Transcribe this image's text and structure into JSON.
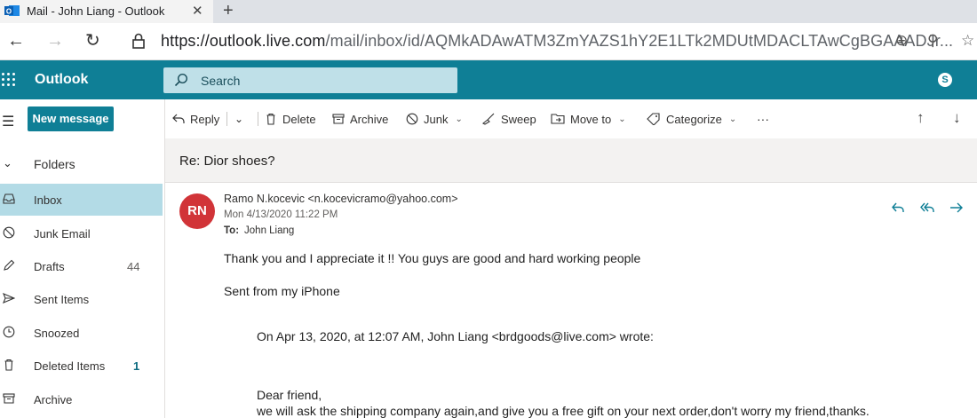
{
  "browser": {
    "tab_title": "Mail - John Liang - Outlook",
    "tab_close": "✕",
    "new_tab": "+",
    "back": "←",
    "forward": "→",
    "refresh": "↻",
    "url_host": "https://outlook.live.com",
    "url_path": "/mail/inbox/id/AQMkADAwATM3ZmYAZS1hY2E1LTk2MDUtMDACLTAwCgBGAAADJr...",
    "add_icon": "⊕",
    "zoom_icon": "⚲",
    "favorite_icon": "☆"
  },
  "header": {
    "brand": "Outlook",
    "search_placeholder": "Search",
    "skype": "S"
  },
  "leftnav": {
    "hamburger": "☰",
    "new_message": "New message",
    "folders_chevron": "⌄",
    "folders_label": "Folders",
    "folders": [
      {
        "name": "Inbox",
        "count": "",
        "icon": "inbox-icon"
      },
      {
        "name": "Junk Email",
        "count": "",
        "icon": "junk-icon"
      },
      {
        "name": "Drafts",
        "count": "44",
        "icon": "pencil-icon"
      },
      {
        "name": "Sent Items",
        "count": "",
        "icon": "send-icon"
      },
      {
        "name": "Snoozed",
        "count": "",
        "icon": "clock-icon"
      },
      {
        "name": "Deleted Items",
        "count": "1",
        "icon": "trash-icon"
      },
      {
        "name": "Archive",
        "count": "",
        "icon": "archive-icon"
      }
    ]
  },
  "commands": {
    "reply": "Reply",
    "dropdown": "⌄",
    "delete": "Delete",
    "archive": "Archive",
    "junk": "Junk",
    "sweep": "Sweep",
    "move_to": "Move to",
    "categorize": "Categorize",
    "more": "···",
    "up": "↑",
    "down": "↓"
  },
  "message": {
    "subject": "Re: Dior shoes?",
    "avatar_initials": "RN",
    "sender": "Ramo N.kocevic <n.kocevicramo@yahoo.com>",
    "date": "Mon 4/13/2020 11:22 PM",
    "to_label": "To:",
    "to_name": "John Liang",
    "lines": [
      "Thank you and I appreciate it !! You guys are good and hard working people",
      "Sent from my iPhone",
      "On Apr 13, 2020, at 12:07 AM, John Liang <brdgoods@live.com> wrote:",
      "Dear friend,",
      "we will ask the shipping company again,and give you a free gift on your next order,don't worry my friend,thanks."
    ]
  },
  "colors": {
    "brand": "#0f7f96",
    "selected_folder": "#b3dbe6",
    "avatar": "#d13438"
  }
}
